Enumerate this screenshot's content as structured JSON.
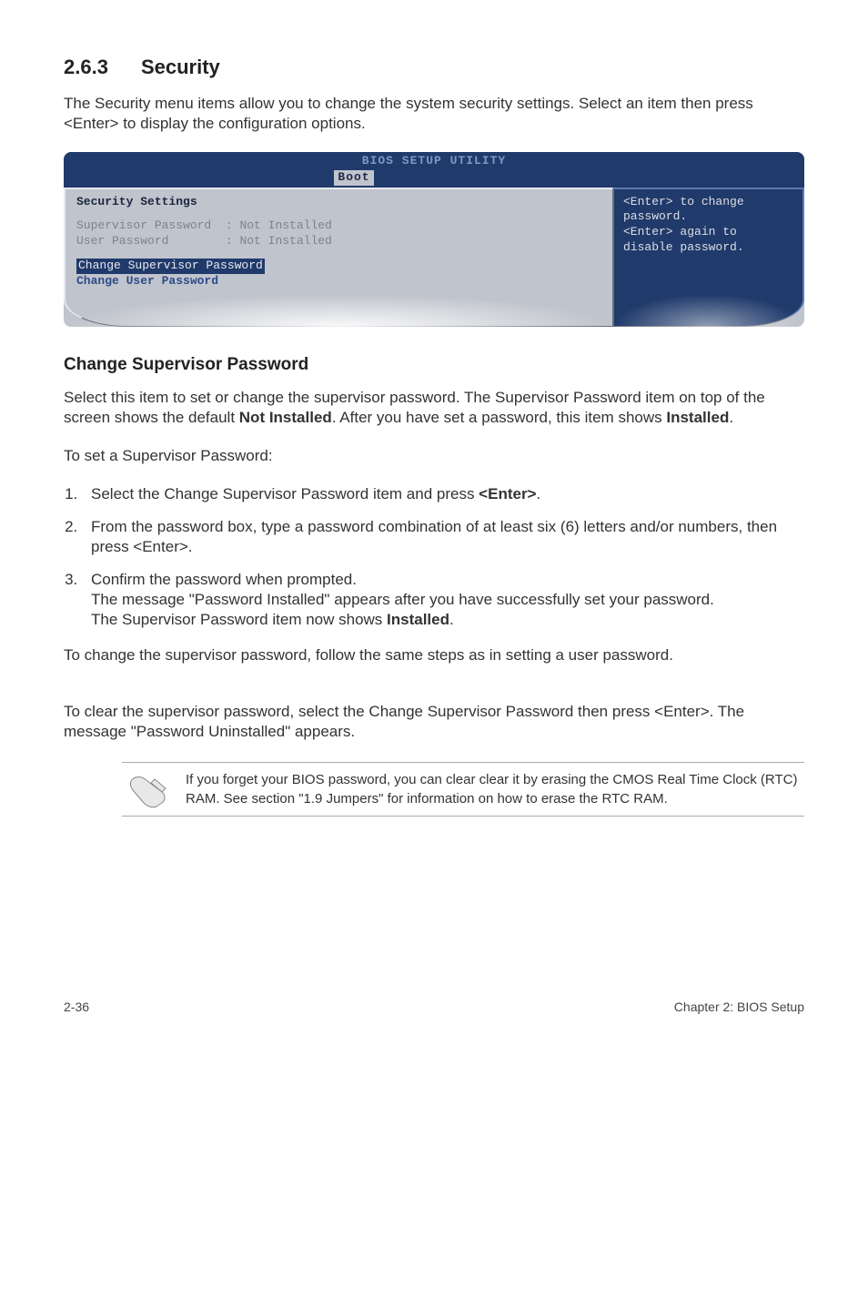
{
  "heading": {
    "number": "2.6.3",
    "title": "Security"
  },
  "intro": "The Security menu items allow you to change the system security settings. Select an item then press <Enter> to display the configuration options.",
  "bios": {
    "title": "BIOS SETUP UTILITY",
    "tab": "Boot",
    "settings_title": "Security Settings",
    "sup_label": "Supervisor Password",
    "sup_value": ": Not Installed",
    "user_label": "User Password",
    "user_value": ": Not Installed",
    "change_sup": "Change Supervisor Password",
    "change_user": "Change User Password",
    "help1": "<Enter> to change",
    "help2": "password.",
    "help3": "<Enter> again to",
    "help4": "disable password."
  },
  "sub1": {
    "title": "Change Supervisor Password",
    "p1_a": "Select this item to set or change the supervisor password. The Supervisor Password item on top of the screen shows the default ",
    "p1_bold1": "Not Installed",
    "p1_b": ". After you have set a password, this item shows ",
    "p1_bold2": "Installed",
    "p1_c": ".",
    "p2": "To set a Supervisor Password:",
    "steps": {
      "s1_a": "Select the Change Supervisor Password item and press ",
      "s1_bold": "<Enter>",
      "s1_b": ".",
      "s2": "From the password box, type a password combination of at least six (6) letters and/or numbers, then press <Enter>.",
      "s3_a": "Confirm the password when prompted.",
      "s3_b": "The message \"Password Installed\" appears after you have successfully set your password.",
      "s3_c": "The Supervisor Password item now shows ",
      "s3_bold": "Installed",
      "s3_d": "."
    },
    "p3": "To change the supervisor password, follow the same steps as in setting a user password.",
    "p4": "To clear the supervisor password, select the Change Supervisor Password then press <Enter>. The message \"Password Uninstalled\" appears."
  },
  "note": "If you forget your BIOS password, you can clear clear it by erasing the CMOS Real Time Clock (RTC) RAM. See section \"1.9  Jumpers\" for information on how to erase the RTC RAM.",
  "footer": {
    "left": "2-36",
    "right": "Chapter 2: BIOS Setup"
  }
}
